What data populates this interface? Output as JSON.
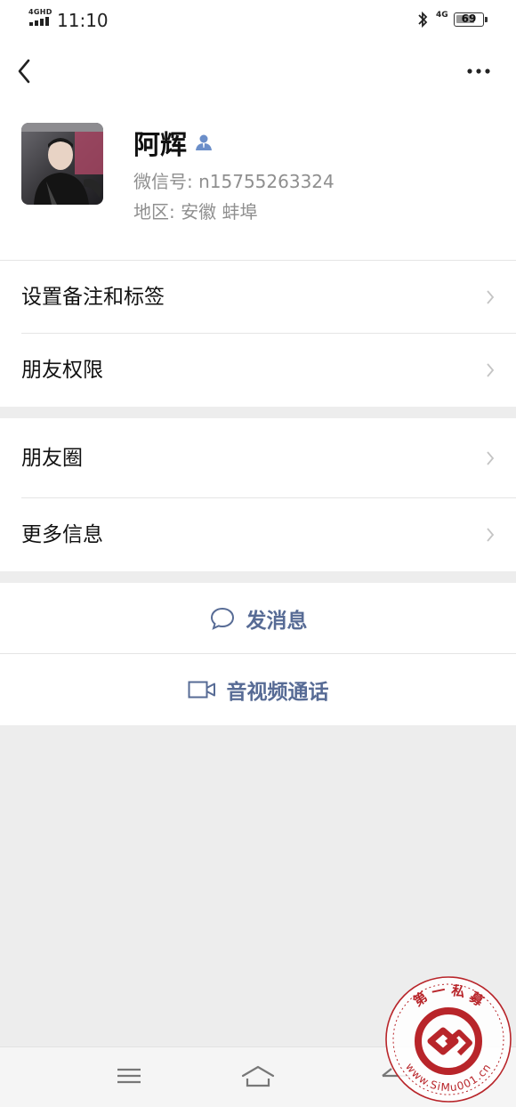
{
  "status_bar": {
    "network": "4GHD",
    "time": "11:10",
    "mobile_data": "4G",
    "battery": "69",
    "icons": [
      "signal-icon",
      "bluetooth-icon",
      "battery-icon"
    ]
  },
  "nav": {
    "back_icon": "chevron-left-icon",
    "more_icon": "more-dots-icon"
  },
  "profile": {
    "name": "阿辉",
    "wechat_id": "微信号: n15755263324",
    "region": "地区: 安徽  蚌埠"
  },
  "menu_group_1": [
    {
      "label": "设置备注和标签"
    },
    {
      "label": "朋友权限"
    }
  ],
  "menu_group_2": [
    {
      "label": "朋友圈"
    },
    {
      "label": "更多信息"
    }
  ],
  "actions": {
    "send_message": "发消息",
    "video_call": "音视频通话"
  },
  "system_nav": {
    "icons": [
      "menu-icon",
      "home-icon",
      "back-icon"
    ]
  },
  "watermark": {
    "top_text": "第 一 私 募",
    "bottom_text": "www.SiMu001.cn"
  },
  "colors": {
    "link_blue": "#576b95",
    "secondary_text": "#8f8f8f",
    "background": "#ededed",
    "watermark_red": "#b8252a"
  }
}
